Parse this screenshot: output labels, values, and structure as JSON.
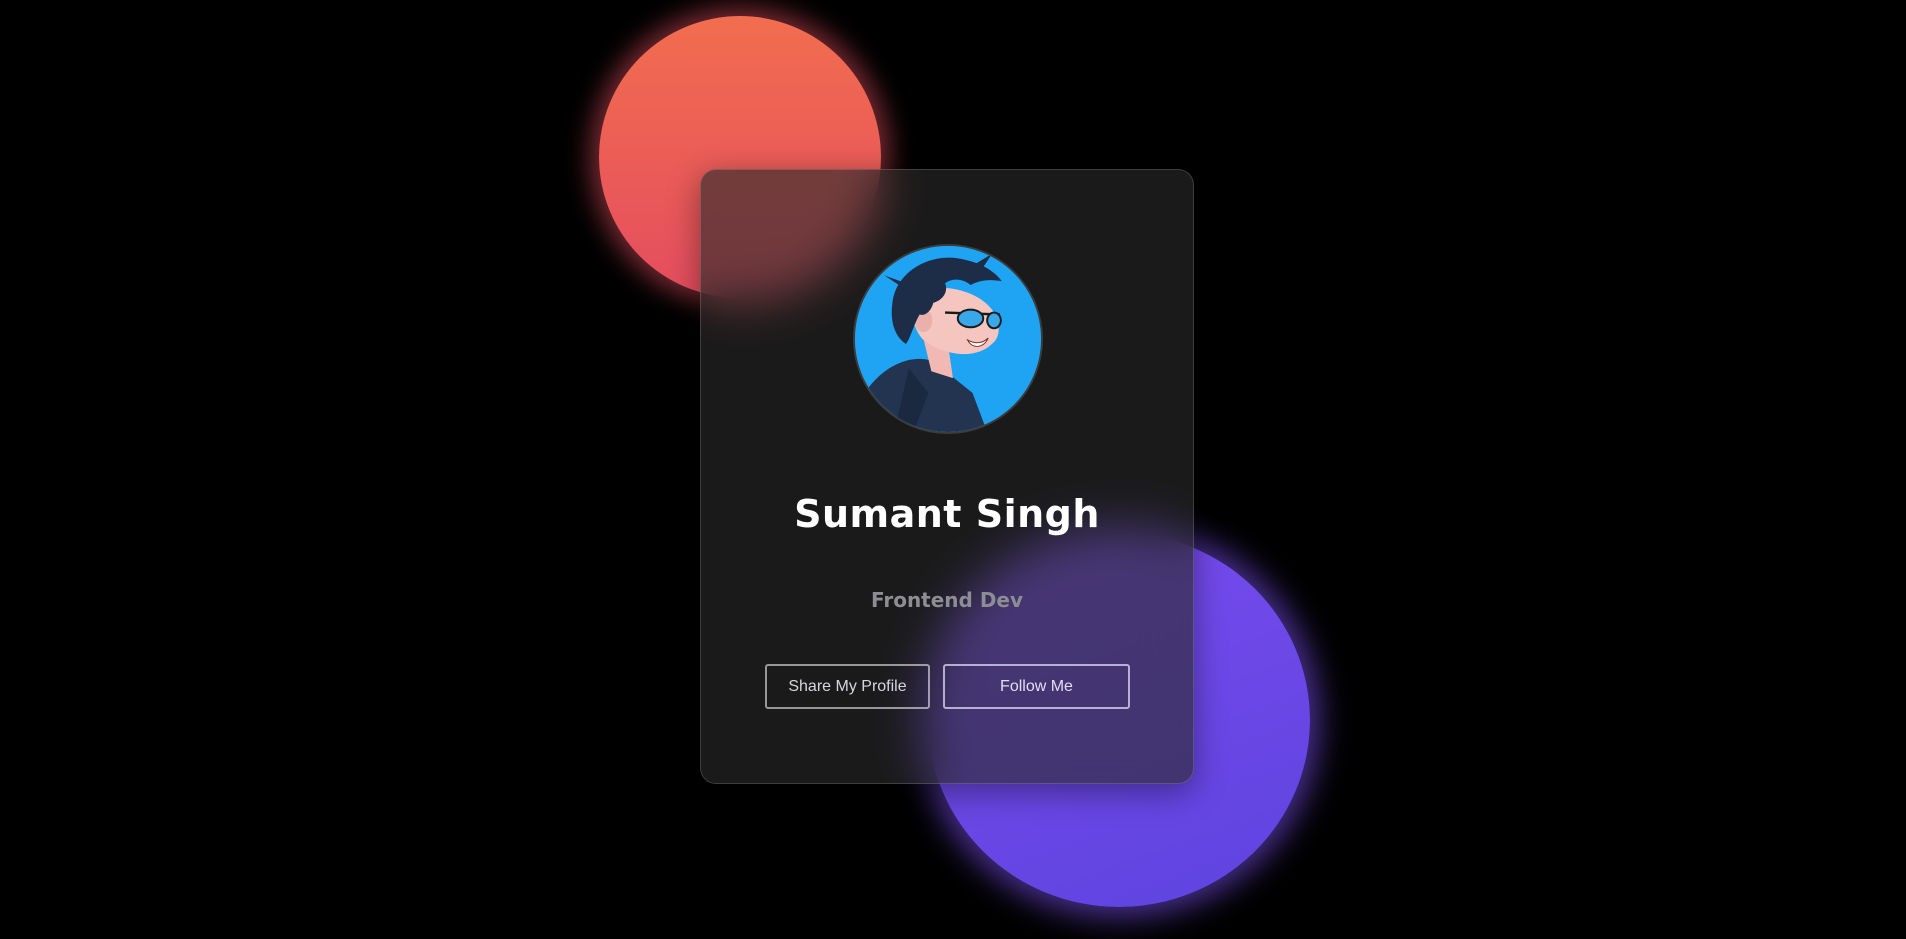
{
  "profile": {
    "name": "Sumant Singh",
    "role": "Frontend Dev",
    "avatar": "anime-developer-avatar"
  },
  "actions": {
    "share_label": "Share My Profile",
    "follow_label": "Follow Me"
  },
  "colors": {
    "background": "#000000",
    "orb_red": "#e8505f",
    "orb_purple": "#6a48e6",
    "avatar_bg": "#1fa4f3",
    "name_text": "#ffffff",
    "role_text": "#8d8d94"
  }
}
